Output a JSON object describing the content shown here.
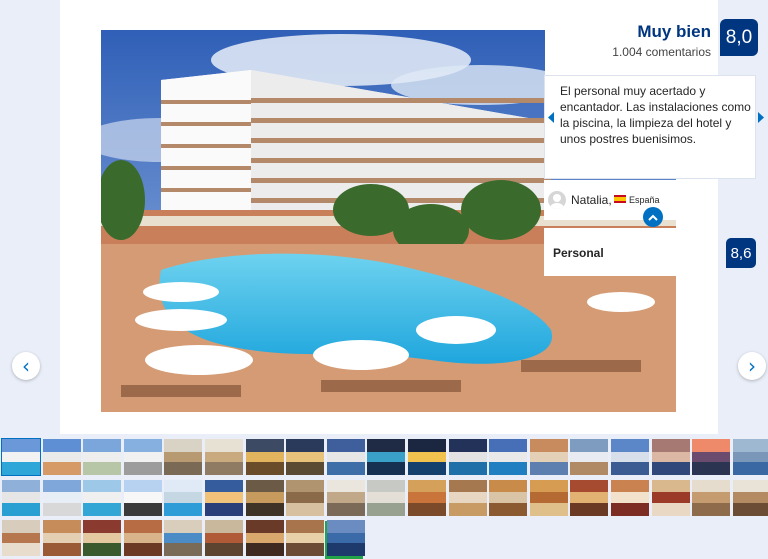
{
  "review": {
    "rating_word": "Muy bien",
    "review_count": "1.004 comentarios",
    "score": "8,0",
    "text": "El personal muy acertado y encantador. Las instalaciones como la piscina, la limpieza del hotel y unos postres buenisimos.",
    "reviewer_name": "Natalia,",
    "reviewer_country": "España"
  },
  "category": {
    "label": "Personal",
    "score": "8,6"
  },
  "nav": {
    "prev_glyph": "‹",
    "next_glyph": "›"
  },
  "colors": {
    "brand_dark": "#003580",
    "brand_blue": "#0071c2",
    "unlock_green": "#22a449"
  },
  "icons": {
    "unlock": "unlock-icon",
    "avatar": "user-avatar-icon",
    "flag": "spain-flag-icon",
    "collapse": "chevron-up-icon"
  },
  "thumbnails": [
    {
      "sky": "#6a98d8",
      "mid": "#f2f2f2",
      "bot": "#2ea7d8"
    },
    {
      "sky": "#5e8ed4",
      "mid": "#eaeaea",
      "bot": "#d69a66"
    },
    {
      "sky": "#7aa6dc",
      "mid": "#eeeeee",
      "bot": "#b8c6a8"
    },
    {
      "sky": "#86b0e0",
      "mid": "#f1f1f1",
      "bot": "#9c9c9c"
    },
    {
      "sky": "#d9d3c6",
      "mid": "#b89a72",
      "bot": "#7a6a55"
    },
    {
      "sky": "#e7e1d4",
      "mid": "#c9a97e",
      "bot": "#8f7b63"
    },
    {
      "sky": "#3d4a63",
      "mid": "#e2b45e",
      "bot": "#6b4c2a"
    },
    {
      "sky": "#2a3a5a",
      "mid": "#e6c27a",
      "bot": "#5a4a34"
    },
    {
      "sky": "#3f5f9c",
      "mid": "#e6e6e6",
      "bot": "#3e6ea8"
    },
    {
      "sky": "#1f2a44",
      "mid": "#3aa0c8",
      "bot": "#153050"
    },
    {
      "sky": "#1b2640",
      "mid": "#f2c24f",
      "bot": "#14406e"
    },
    {
      "sky": "#223258",
      "mid": "#e3e3e3",
      "bot": "#1f6fa8"
    },
    {
      "sky": "#466fb8",
      "mid": "#e9e9e9",
      "bot": "#1f7fc0"
    },
    {
      "sky": "#c88b5d",
      "mid": "#e4d0b6",
      "bot": "#5c7fb0"
    },
    {
      "sky": "#7d9cc0",
      "mid": "#e8ecf2",
      "bot": "#b08a64"
    },
    {
      "sky": "#5b86c8",
      "mid": "#d6dfea",
      "bot": "#3a5c92"
    },
    {
      "sky": "#a67a72",
      "mid": "#dcb8a4",
      "bot": "#31497a"
    },
    {
      "sky": "#ee8a6a",
      "mid": "#6b4b6e",
      "bot": "#2b3552"
    },
    {
      "sky": "#9fb8d2",
      "mid": "#7a96b8",
      "bot": "#3a68a2"
    },
    {
      "sky": "#8fb0d8",
      "mid": "#e6e6e6",
      "bot": "#2aa0d2"
    },
    {
      "sky": "#7fa7da",
      "mid": "#e8eef6",
      "bot": "#d8d8d8"
    },
    {
      "sky": "#9ec8e8",
      "mid": "#f0f0f0",
      "bot": "#33a6d6"
    },
    {
      "sky": "#b7d2f0",
      "mid": "#f7f7f7",
      "bot": "#3a3a3a"
    },
    {
      "sky": "#dfeaf6",
      "mid": "#c6d7e4",
      "bot": "#2e9cd6"
    },
    {
      "sky": "#355c9c",
      "mid": "#f0c27a",
      "bot": "#2b3e7a"
    },
    {
      "sky": "#6b5a46",
      "mid": "#c79a5e",
      "bot": "#3f3226"
    },
    {
      "sky": "#b09470",
      "mid": "#8a6a48",
      "bot": "#d7c0a0"
    },
    {
      "sky": "#eae6de",
      "mid": "#c0a888",
      "bot": "#7c6a58"
    },
    {
      "sky": "#c7c9c4",
      "mid": "#e3dfd6",
      "bot": "#98a090"
    },
    {
      "sky": "#d4a05a",
      "mid": "#c8743a",
      "bot": "#7a4a2a"
    },
    {
      "sky": "#a67850",
      "mid": "#e7d6c2",
      "bot": "#c89a64"
    },
    {
      "sky": "#c88b4a",
      "mid": "#d9c5a6",
      "bot": "#8c5a30"
    },
    {
      "sky": "#d59c52",
      "mid": "#b56a34",
      "bot": "#e0c08a"
    },
    {
      "sky": "#a64b2f",
      "mid": "#e2b272",
      "bot": "#6a3a24"
    },
    {
      "sky": "#c98250",
      "mid": "#f2e2cc",
      "bot": "#7c2c22"
    },
    {
      "sky": "#d8b88c",
      "mid": "#9c3a2a",
      "bot": "#e8d8c4"
    },
    {
      "sky": "#e6dccd",
      "mid": "#c59b70",
      "bot": "#8e6b4a"
    },
    {
      "sky": "#e9e2d6",
      "mid": "#b48a62",
      "bot": "#6d4c36"
    },
    {
      "sky": "#d8ccbc",
      "mid": "#b7774e",
      "bot": "#e8dccd"
    },
    {
      "sky": "#c68c5a",
      "mid": "#e4cfb2",
      "bot": "#9a5a36"
    },
    {
      "sky": "#8a3a2e",
      "mid": "#e4c8a0",
      "bot": "#3a5a2e"
    },
    {
      "sky": "#b86c44",
      "mid": "#d9b48a",
      "bot": "#6c3a24"
    },
    {
      "sky": "#d9cdbb",
      "mid": "#4c8cc6",
      "bot": "#7a6a58"
    },
    {
      "sky": "#c9b89c",
      "mid": "#b05a38",
      "bot": "#5c4430"
    },
    {
      "sky": "#6a3a28",
      "mid": "#d8a86c",
      "bot": "#3e2a20"
    },
    {
      "sky": "#a8744c",
      "mid": "#e8d0a8",
      "bot": "#6c4c34"
    },
    {
      "sky": "#6a8cc0",
      "mid": "#3a6aa8",
      "bot": "#1e3a6c"
    }
  ]
}
